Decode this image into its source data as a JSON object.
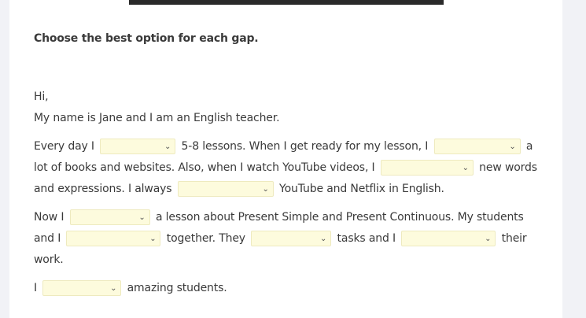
{
  "instructions": "Choose the best option for each gap.",
  "greeting": "Hi,",
  "intro": "My name is Jane and I am an English teacher.",
  "p1": {
    "t1": "Every day I",
    "t2": "5-8 lessons. When I get ready for my lesson, I",
    "t3": "a",
    "t4": "lot of books and websites. Also, when I watch YouTube videos, I",
    "t5": "new words",
    "t6": "and expressions. I always",
    "t7": "YouTube and Netflix in English."
  },
  "p2": {
    "t1": "Now I",
    "t2": "a lesson about Present Simple and Present Continuous. My students",
    "t3": "and I",
    "t4": "together. They",
    "t5": "tasks and I",
    "t6": "their",
    "t7": "work."
  },
  "p3": {
    "t1": "I",
    "t2": "amazing students."
  },
  "dropdown_selected_value": "",
  "colors": {
    "dropdown_bg": "#fdfbdd",
    "text": "#3a3a3a",
    "page_bg": "#f1f2f6"
  },
  "icons": {
    "dropdown": "chevron-down-icon"
  }
}
